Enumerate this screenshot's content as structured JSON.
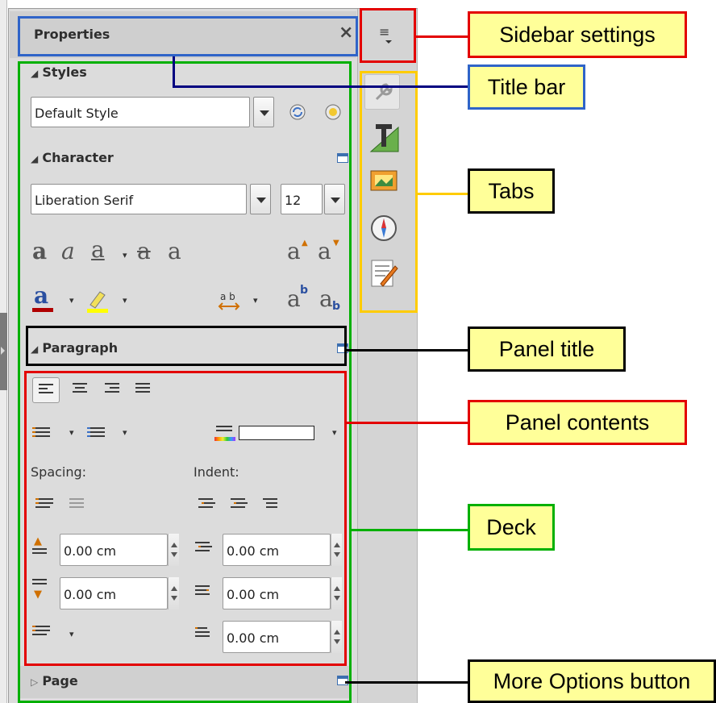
{
  "sidebar": {
    "title": "Properties",
    "close_glyph": "×",
    "menu_glyph": "≡",
    "panels": {
      "styles": {
        "title": "Styles",
        "style_value": "Default Style",
        "icons": [
          "update-style-icon",
          "new-style-icon"
        ]
      },
      "character": {
        "title": "Character",
        "font_value": "Liberation Serif",
        "size_value": "12",
        "format_icons": [
          "bold-icon",
          "italic-icon",
          "underline-icon",
          "strikethrough-icon",
          "shadow-icon",
          "grow-font-icon",
          "shrink-font-icon"
        ],
        "color_icons": [
          "font-color-icon",
          "highlight-icon",
          "character-spacing-icon",
          "superscript-icon",
          "subscript-icon"
        ],
        "glyph_a": "a"
      },
      "paragraph": {
        "title": "Paragraph",
        "spacing_label": "Spacing:",
        "indent_label": "Indent:",
        "above_value": "0.00 cm",
        "below_value": "0.00 cm",
        "before_value": "0.00 cm",
        "after_value": "0.00 cm",
        "first_line_value": "0.00 cm"
      },
      "page": {
        "title": "Page"
      }
    },
    "tabs": [
      "properties-tab-icon",
      "styles-tab-icon",
      "gallery-tab-icon",
      "navigator-tab-icon",
      "manage-changes-tab-icon"
    ]
  },
  "annotations": {
    "sidebar_settings": "Sidebar settings",
    "title_bar": "Title bar",
    "tabs": "Tabs",
    "panel_title": "Panel title",
    "panel_contents": "Panel contents",
    "deck": "Deck",
    "more_options": "More Options button"
  },
  "colors": {
    "red": "#e30000",
    "blue": "#2f64c8",
    "green": "#00b000",
    "yellow": "#ffcc00",
    "navy": "#000080",
    "note_fill": "#ffff99"
  }
}
